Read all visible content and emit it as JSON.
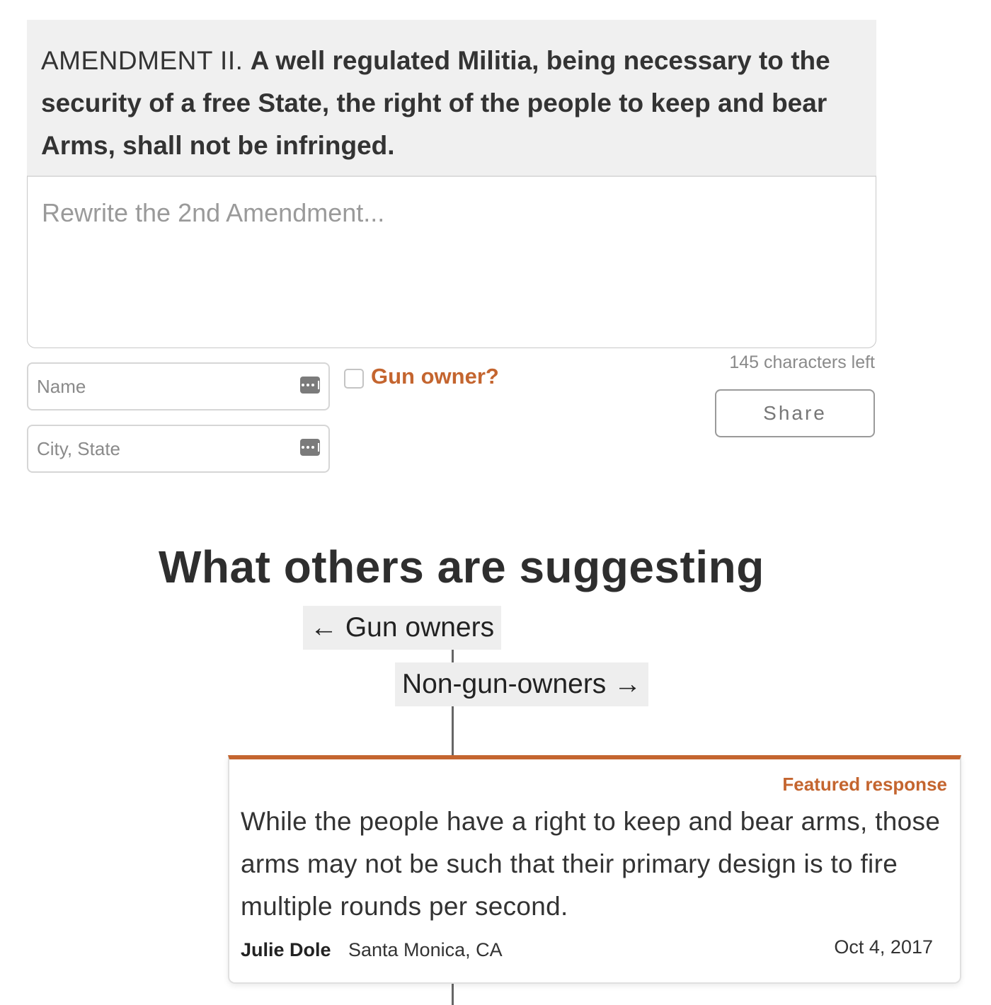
{
  "amendment": {
    "lead": "AMENDMENT II.",
    "text": "A well regulated Militia, being necessary to the security of a free State, the right of the people to keep and bear Arms, shall not be infringed."
  },
  "form": {
    "rewrite_placeholder": "Rewrite the 2nd Amendment...",
    "name_placeholder": "Name",
    "city_placeholder": "City, State",
    "gun_owner_label": "Gun owner?",
    "chars_left": "145 characters left",
    "share_label": "Share"
  },
  "suggestions": {
    "heading": "What others are suggesting",
    "filters": {
      "gun_owners": "← Gun owners",
      "non_gun_owners": "Non-gun-owners →"
    }
  },
  "featured_response": {
    "label": "Featured response",
    "text": "While the people have a right to keep and bear arms, those arms may not be such that their primary design is to fire multiple rounds per second.",
    "author": "Julie Dole",
    "location": "Santa Monica, CA",
    "date": "Oct 4, 2017"
  },
  "colors": {
    "accent": "#c4652f",
    "panel_bg": "#f0f0f0",
    "text": "#333333"
  },
  "icons": {
    "field_autofill": "key-autofill-icon"
  }
}
